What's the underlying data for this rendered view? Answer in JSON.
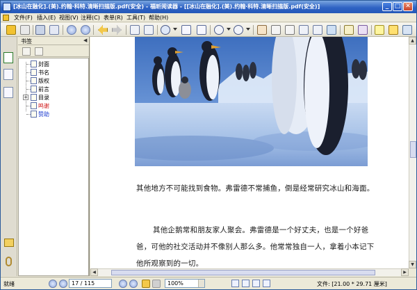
{
  "window": {
    "title": "[冰山在融化].(美).约翰·科特.清晰扫描版.pdf(安全) - 福昕阅读器 - [[冰山在融化].(美).约翰·科特.清晰扫描版.pdf(安全)]",
    "min_glyph": "_",
    "max_glyph": "□",
    "close_glyph": "✕"
  },
  "menu": {
    "items": [
      "文件(F)",
      "插入(E)",
      "视图(V)",
      "注释(C)",
      "表单(R)",
      "工具(T)",
      "帮助(H)"
    ]
  },
  "toolbar": {
    "icons": [
      "open-icon",
      "save-icon",
      "print-icon",
      "email-icon",
      "first-page-icon",
      "prev-page-icon",
      "back-icon",
      "forward-icon",
      "copy-icon",
      "snapshot-icon",
      "zoom-icon",
      "fit-page-icon",
      "fit-width-icon",
      "zoom-out-icon",
      "zoom-in-icon",
      "hand-tool-icon",
      "text-select-icon",
      "annotation-select-icon",
      "text-tool-icon",
      "typewriter-icon",
      "image-icon",
      "note-icon",
      "highlight-icon",
      "comment-icon"
    ]
  },
  "sidebar": {
    "panel_title": "书签",
    "close_glyph": "◀",
    "bookmarks": [
      {
        "label": "封面",
        "color": "#000000"
      },
      {
        "label": "书名",
        "color": "#000000"
      },
      {
        "label": "版权",
        "color": "#000000"
      },
      {
        "label": "前言",
        "color": "#000000"
      },
      {
        "label": "目录",
        "color": "#000000",
        "expandable": true
      },
      {
        "label": "鸣谢",
        "color": "#d01818"
      },
      {
        "label": "赞助",
        "color": "#1a3ad0"
      }
    ]
  },
  "document": {
    "paragraph1": "其他地方不可能找到食物。弗雷德不常捕鱼，倒是经常研究冰山和海面。",
    "paragraph2": "其他企鹅常和朋友家人聚会。弗雷德是一个好丈夫，也是一个好爸爸，可他的社交活动并不像别人那么多。他常常独自一人，拿着小本记下他所观察到的一切。"
  },
  "statusbar": {
    "ready": "就绪",
    "page": "17 / 115",
    "zoom": "100%",
    "doc_size": "文件: [21.00 * 29.71 厘米]"
  }
}
